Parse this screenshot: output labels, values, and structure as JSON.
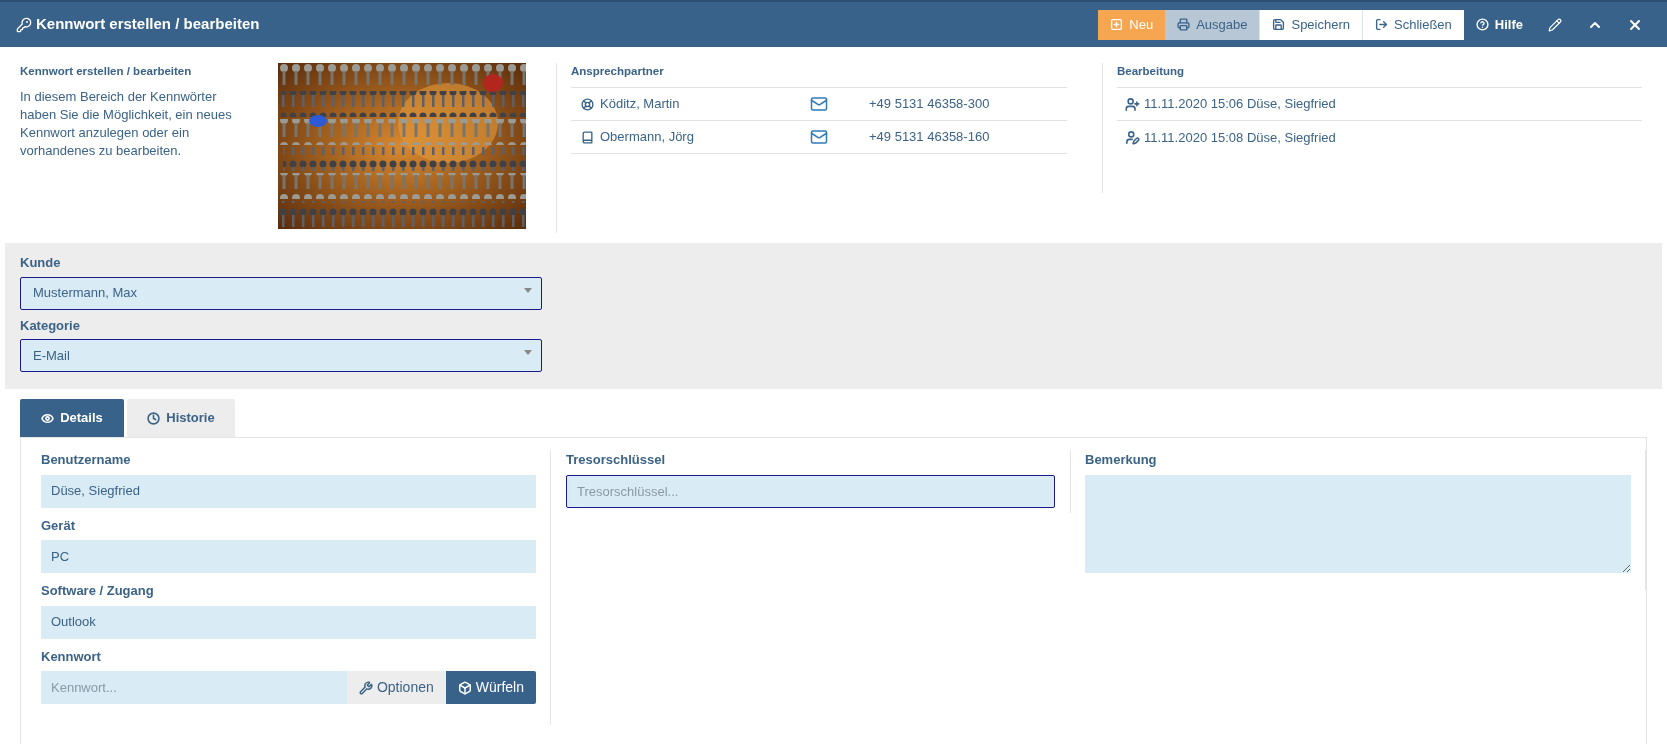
{
  "header": {
    "title": "Kennwort erstellen / bearbeiten",
    "buttons": [
      {
        "label": "Neu"
      },
      {
        "label": "Ausgabe"
      },
      {
        "label": "Speichern"
      },
      {
        "label": "Schließen"
      },
      {
        "label": "Hilfe"
      }
    ]
  },
  "intro": {
    "title": "Kennwort erstellen / bearbeiten",
    "text": "In diesem Bereich der Kennwörter haben Sie die Möglichkeit, ein neues Kennwort anzulegen oder ein vorhandenes zu bearbeiten."
  },
  "contacts": {
    "title": "Ansprechpartner",
    "items": [
      {
        "name": "Köditz, Martin",
        "phone": "+49 5131 46358-300"
      },
      {
        "name": "Obermann, Jörg",
        "phone": "+49 5131 46358-160"
      }
    ]
  },
  "history": {
    "title": "Bearbeitung",
    "items": [
      {
        "text": "11.11.2020 15:06 Düse, Siegfried"
      },
      {
        "text": "11.11.2020 15:08 Düse, Siegfried"
      }
    ]
  },
  "selects": [
    {
      "label": "Kunde",
      "value": "Mustermann, Max",
      "outlined": true
    },
    {
      "label": "Kategorie",
      "value": "E-Mail",
      "outlined": true
    }
  ],
  "tabs": [
    {
      "label": "Details",
      "selected": true
    },
    {
      "label": "Historie",
      "selected": false
    }
  ],
  "fields": [
    {
      "label": "Benutzername",
      "value": "Düse, Siegfried",
      "outlined": false
    },
    {
      "label": "Gerät",
      "value": "PC",
      "outlined": false
    },
    {
      "label": "Software / Zugang",
      "value": "Outlook",
      "outlined": false
    }
  ],
  "password": {
    "label": "Kennwort",
    "placeholder": "Kennwort...",
    "buttons": [
      {
        "label": "Optionen"
      },
      {
        "label": "Würfeln"
      }
    ]
  },
  "vault": {
    "label": "Tresorschlüssel",
    "placeholder": "Tresorschlüssel...",
    "outlined": true
  },
  "remark": {
    "label": "Bemerkung"
  }
}
